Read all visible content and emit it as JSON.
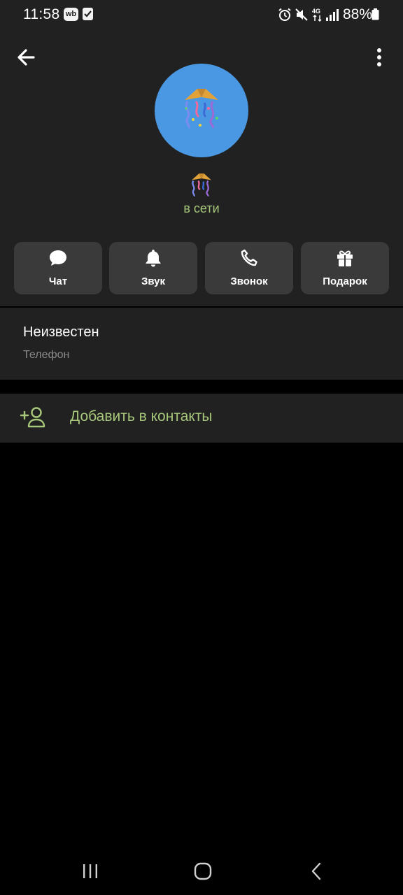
{
  "status_bar": {
    "time": "11:58",
    "wb_badge": "wb",
    "battery": "88%",
    "icons": [
      "alarm-icon",
      "mute-icon",
      "4g-icon",
      "signal-icon",
      "battery-icon"
    ]
  },
  "header": {
    "back_icon": "arrow-left-icon",
    "more_icon": "more-vertical-icon",
    "avatar_color": "#4a98e3",
    "avatar_icon": "party-popper-icon",
    "status_text": "в сети",
    "status_color": "#a7c77a"
  },
  "actions": [
    {
      "label": "Чат",
      "icon": "chat-bubble-icon"
    },
    {
      "label": "Звук",
      "icon": "bell-icon"
    },
    {
      "label": "Звонок",
      "icon": "phone-icon"
    },
    {
      "label": "Подарок",
      "icon": "gift-icon"
    }
  ],
  "info": {
    "value": "Неизвестен",
    "label": "Телефон"
  },
  "add_contact": {
    "label": "Добавить в контакты",
    "icon": "add-person-icon"
  },
  "nav": {
    "icons": [
      "recents-icon",
      "home-icon",
      "back-icon"
    ]
  },
  "colors": {
    "surface": "#212121",
    "button": "#3a3a3a",
    "accent_green": "#a7c77a",
    "background": "#000000"
  }
}
